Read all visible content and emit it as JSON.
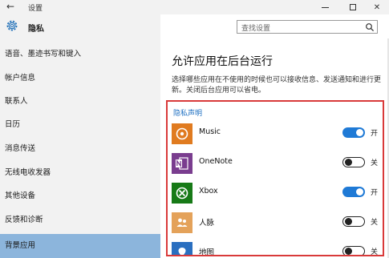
{
  "window": {
    "back_glyph": "←",
    "title": "设置",
    "close_glyph": "✕"
  },
  "sidebar": {
    "header_label": "隐私",
    "items": [
      {
        "label": "语音、墨迹书写和键入"
      },
      {
        "label": "帐户信息"
      },
      {
        "label": "联系人"
      },
      {
        "label": "日历"
      },
      {
        "label": "消息传送"
      },
      {
        "label": "无线电收发器"
      },
      {
        "label": "其他设备"
      },
      {
        "label": "反馈和诊断"
      },
      {
        "label": "背景应用",
        "active": true
      }
    ]
  },
  "search": {
    "placeholder": "查找设置"
  },
  "main": {
    "title": "允许应用在后台运行",
    "description": "选择哪些应用在不使用的时候也可以接收信息、发送通知和进行更新。关闭后台应用可以省电。",
    "privacy_link": "隐私声明",
    "apps": [
      {
        "name": "Music",
        "state": "开",
        "on": true,
        "icon": "music-icon",
        "color": "#e07b20"
      },
      {
        "name": "OneNote",
        "state": "关",
        "on": false,
        "icon": "onenote-icon",
        "color": "#7a3d8f"
      },
      {
        "name": "Xbox",
        "state": "开",
        "on": true,
        "icon": "xbox-icon",
        "color": "#177a17"
      },
      {
        "name": "人脉",
        "state": "关",
        "on": false,
        "icon": "people-icon",
        "color": "#e4a25a"
      },
      {
        "name": "地图",
        "state": "关",
        "on": false,
        "icon": "maps-icon",
        "color": "#2a6fc0"
      }
    ]
  },
  "colors": {
    "accent": "#1f7ad6",
    "selection": "#8cb5dc",
    "highlight_border": "#d93a3a"
  }
}
